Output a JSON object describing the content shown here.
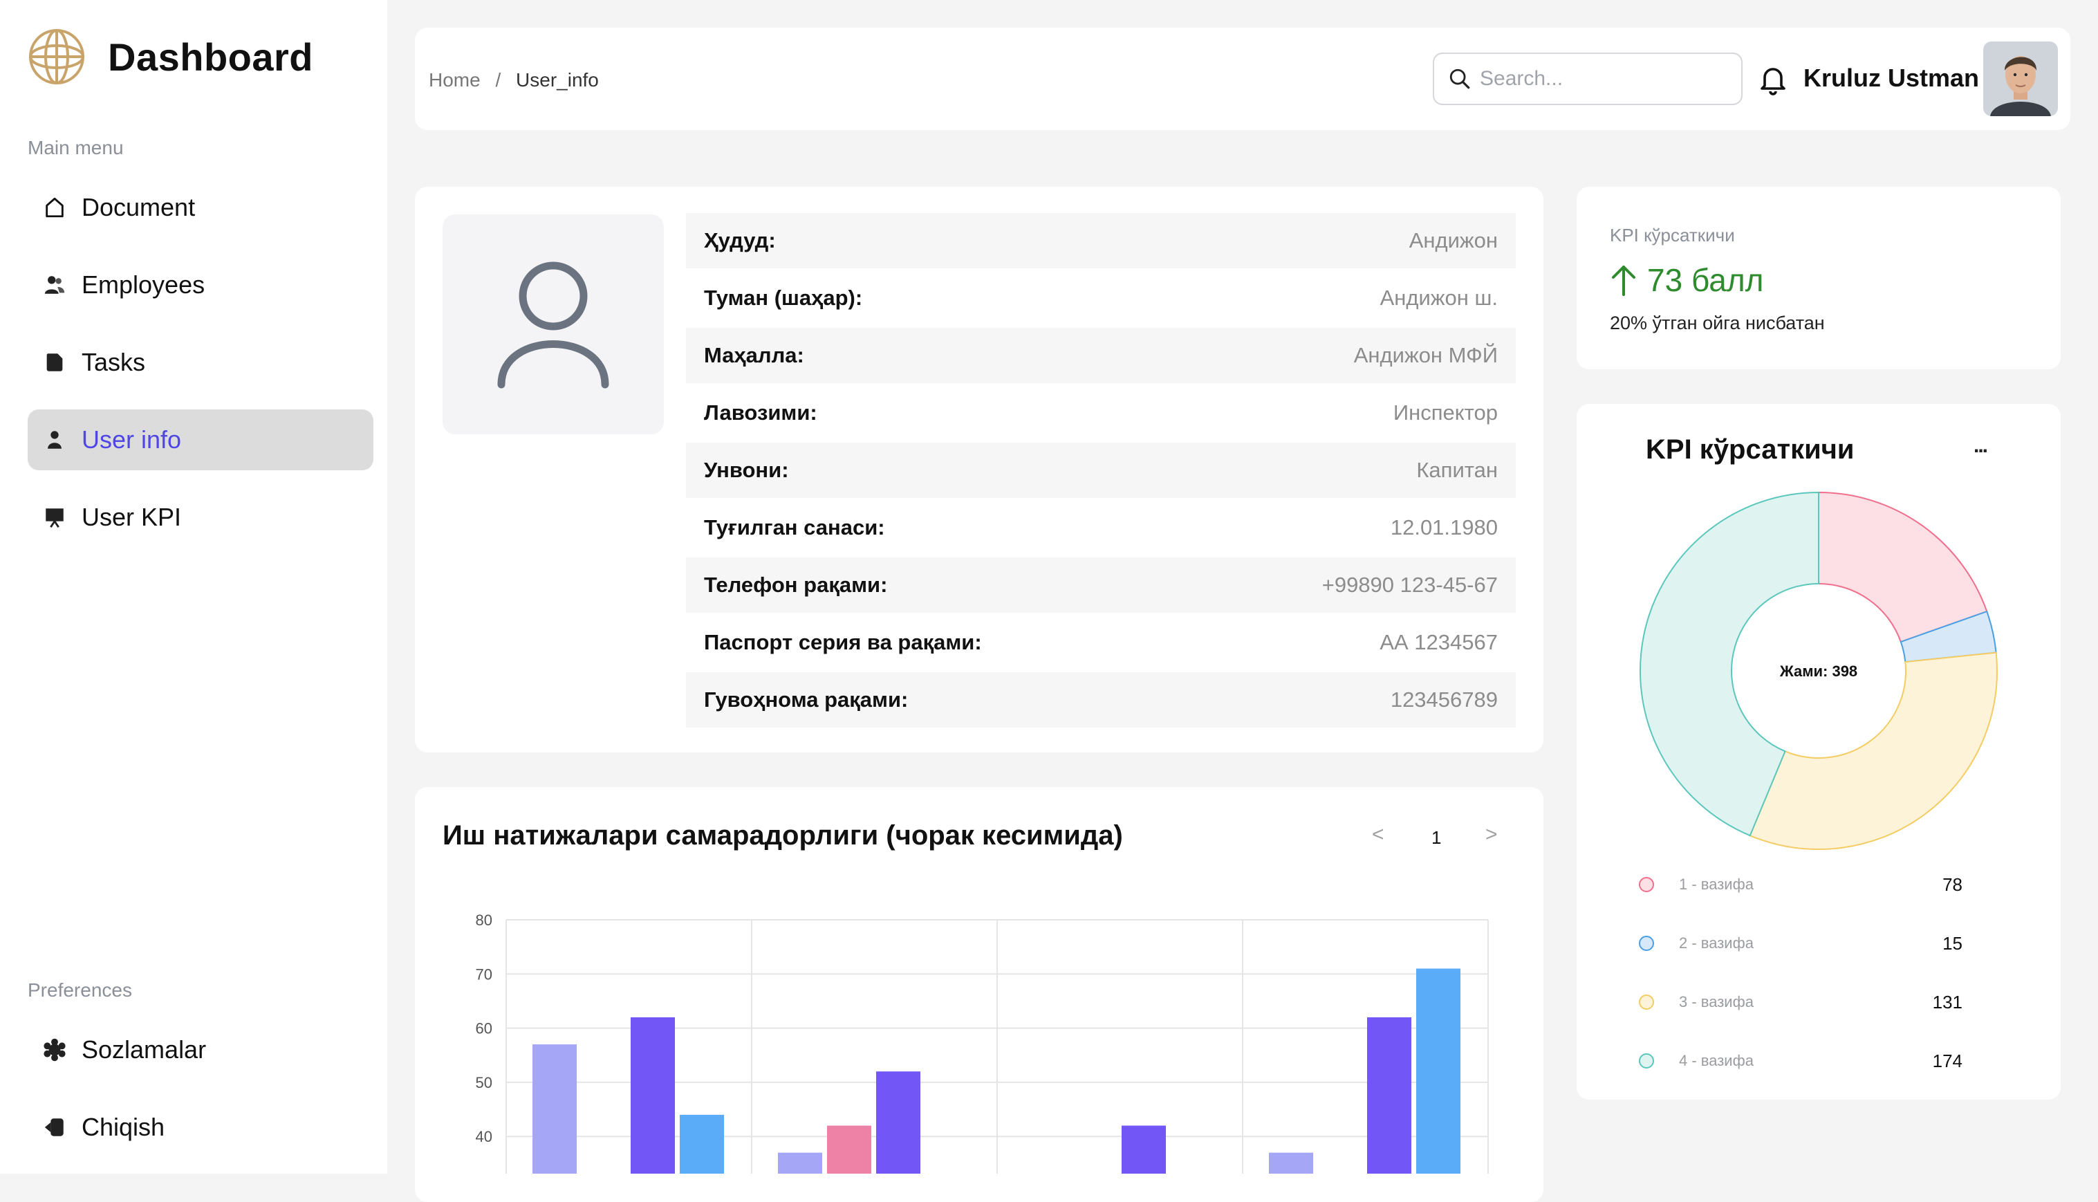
{
  "app": {
    "title": "Dashboard",
    "main_menu_label": "Main menu",
    "preferences_label": "Preferences"
  },
  "sidebar": {
    "items": [
      {
        "label": "Document",
        "icon": "home-icon"
      },
      {
        "label": "Employees",
        "icon": "users-icon"
      },
      {
        "label": "Tasks",
        "icon": "tasks-icon"
      },
      {
        "label": "User info",
        "icon": "user-icon",
        "active": true
      },
      {
        "label": "User KPI",
        "icon": "presentation-icon"
      }
    ],
    "preferences": [
      {
        "label": "Sozlamalar",
        "icon": "settings-icon"
      },
      {
        "label": "Chiqish",
        "icon": "logout-icon"
      }
    ]
  },
  "header": {
    "breadcrumb_home": "Home",
    "breadcrumb_sep": "/",
    "breadcrumb_current": "User_info",
    "search_placeholder": "Search...",
    "user_name": "Kruluz Ustman"
  },
  "profile": {
    "rows": [
      {
        "label": "Ҳудуд:",
        "value": "Андижон"
      },
      {
        "label": "Туман (шаҳар):",
        "value": "Андижон ш."
      },
      {
        "label": "Маҳалла:",
        "value": "Андижон МФЙ"
      },
      {
        "label": "Лавозими:",
        "value": "Инспектор"
      },
      {
        "label": "Унвони:",
        "value": "Капитан"
      },
      {
        "label": "Туғилган санаси:",
        "value": "12.01.1980"
      },
      {
        "label": "Телефон рақами:",
        "value": "+99890 123-45-67"
      },
      {
        "label": "Паспорт серия ва рақами:",
        "value": "АА 1234567"
      },
      {
        "label": "Гувоҳнома рақами:",
        "value": "123456789"
      }
    ]
  },
  "kpi_summary": {
    "title": "KPI кўрсаткичи",
    "score": "73 балл",
    "compare": "20% ўтган ойга нисбатан",
    "accent": "#2e8b2e"
  },
  "kpi_donut": {
    "title": "KPI кўрсаткичи",
    "menu": "...",
    "center_label": "Жами: 398"
  },
  "bar_section": {
    "title": "Иш натижалари самарадорлиги (чорак кесимида)",
    "pager_prev": "<",
    "pager_page": "1",
    "pager_next": ">"
  },
  "chart_data": [
    {
      "type": "pie",
      "variant": "donut",
      "total_label": "Жами: 398",
      "categories": [
        "1 - вазифа",
        "2 - вазифа",
        "3 - вазифа",
        "4 - вазифа"
      ],
      "values": [
        78,
        15,
        131,
        174
      ],
      "fill_colors": [
        "#fde0e6",
        "#d7e8f8",
        "#fdf3d8",
        "#dff3f1"
      ],
      "stroke_colors": [
        "#f06f8c",
        "#4a9fe4",
        "#f4cc63",
        "#5bc7bc"
      ],
      "legend_placement": "bottom"
    },
    {
      "type": "bar",
      "groups": 4,
      "ylim": [
        35,
        80
      ],
      "yticks": [
        40,
        50,
        60,
        70,
        80
      ],
      "grid": true,
      "series": [
        {
          "color": "#a5a6f6",
          "values": [
            57,
            37,
            null,
            37
          ]
        },
        {
          "color": "#ee82a6",
          "values": [
            null,
            42,
            null,
            null
          ]
        },
        {
          "color": "#7357f6",
          "values": [
            62,
            52,
            42,
            62
          ]
        },
        {
          "color": "#5aabf8",
          "values": [
            44,
            null,
            null,
            71
          ]
        }
      ]
    }
  ]
}
